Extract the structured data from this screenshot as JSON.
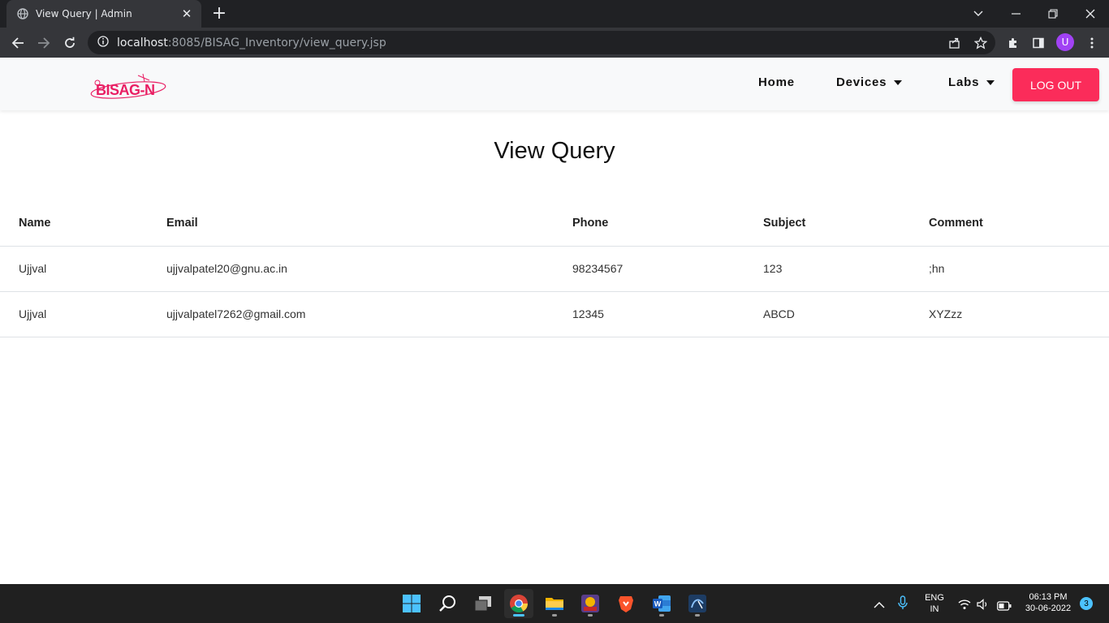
{
  "browser": {
    "tab_title": "View Query | Admin",
    "url_host": "localhost",
    "url_rest": ":8085/BISAG_Inventory/view_query.jsp",
    "profile_initial": "U"
  },
  "navbar": {
    "logo_text": "BISAG-N",
    "items": [
      {
        "label": "Home"
      },
      {
        "label": "Devices"
      },
      {
        "label": "Labs"
      }
    ],
    "logout_label": "LOG OUT",
    "logout_color": "#fb2c5a"
  },
  "page": {
    "title": "View Query"
  },
  "table": {
    "columns": [
      "Name",
      "Email",
      "Phone",
      "Subject",
      "Comment"
    ],
    "rows": [
      [
        "Ujjval",
        "ujjvalpatel20@gnu.ac.in",
        "98234567",
        "123",
        ";hn"
      ],
      [
        "Ujjval",
        "ujjvalpatel7262@gmail.com",
        "12345",
        "ABCD",
        "XYZzz"
      ]
    ]
  },
  "taskbar": {
    "apps": [
      "start-icon",
      "search-icon",
      "task-view-icon",
      "chrome-icon",
      "file-explorer-icon",
      "app-icon",
      "brave-icon",
      "word-icon",
      "mysql-workbench-icon"
    ],
    "language_line1": "ENG",
    "language_line2": "IN",
    "time": "06:13 PM",
    "date": "30-06-2022",
    "notification_count": "3"
  }
}
